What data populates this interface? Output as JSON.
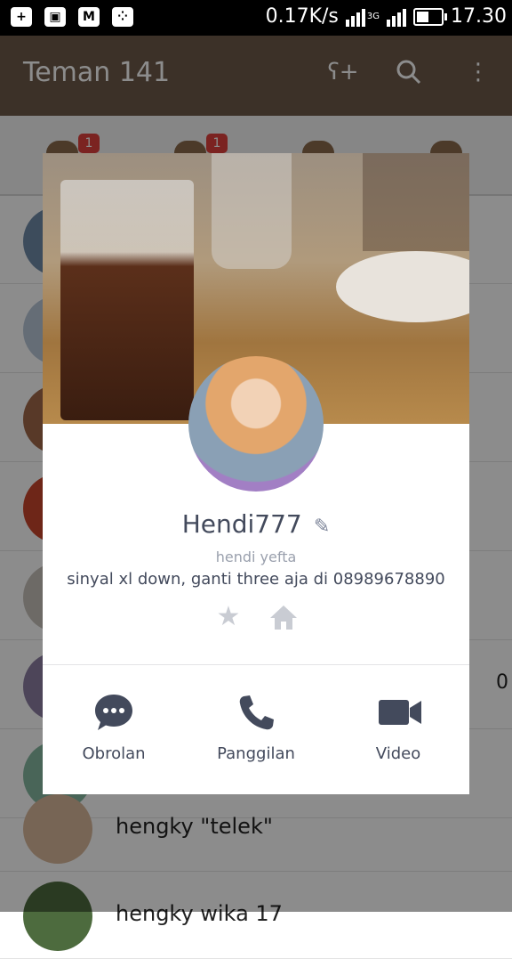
{
  "status_bar": {
    "speed": "0.17K/s",
    "time": "17.30",
    "network_label": "3G",
    "battery_percent": 55
  },
  "app_bar": {
    "title": "Teman 141"
  },
  "tabs": [
    {
      "badge": "1"
    },
    {
      "badge": "1"
    },
    {
      "badge": ""
    },
    {
      "badge": ""
    }
  ],
  "contacts_visible": [
    {
      "name": "hengky \"telek\""
    },
    {
      "name": "hengky wika 17"
    }
  ],
  "partial_background_text": "0",
  "profile": {
    "name": "Hendi777",
    "subname": "hendi yefta",
    "status_message": "sinyal xl down, ganti three aja di 08989678890"
  },
  "actions": {
    "chat_label": "Obrolan",
    "call_label": "Panggilan",
    "video_label": "Video"
  },
  "colors": {
    "app_bar": "#6d5a49",
    "text_dark": "#434a5c",
    "text_muted": "#9aa0ad",
    "badge": "#e0413c"
  }
}
